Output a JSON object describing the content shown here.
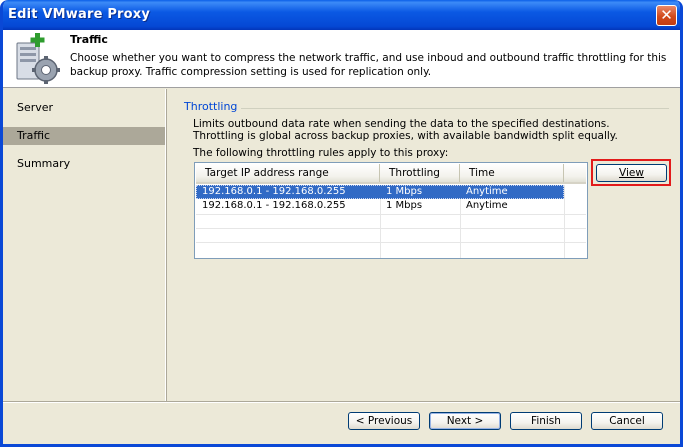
{
  "window": {
    "title": "Edit VMware Proxy"
  },
  "header": {
    "title": "Traffic",
    "description": "Choose whether you want to compress the network traffic, and use inboud and outbound traffic throttling for this backup proxy. Traffic compression setting is used for replication only.",
    "icon": "server-gear-icon"
  },
  "sidebar": {
    "items": [
      {
        "label": "Server",
        "active": false
      },
      {
        "label": "Traffic",
        "active": true
      },
      {
        "label": "Summary",
        "active": false
      }
    ]
  },
  "throttling": {
    "section_title": "Throttling",
    "description_line1": "Limits outbound data rate when sending the data to the specified destinations.",
    "description_line2": "Throttling is global across backup proxies, with available bandwidth split equally.",
    "rules_label": "The following throttling rules apply to this proxy:",
    "columns": [
      "Target IP address range",
      "Throttling",
      "Time"
    ],
    "rows": [
      {
        "range": "192.168.0.1 - 192.168.0.255",
        "throttling": "1 Mbps",
        "time": "Anytime",
        "selected": true
      },
      {
        "range": "192.168.0.1 - 192.168.0.255",
        "throttling": "1 Mbps",
        "time": "Anytime",
        "selected": false
      }
    ],
    "view_button": "View"
  },
  "footer": {
    "previous": "< Previous",
    "next": "Next >",
    "finish": "Finish",
    "cancel": "Cancel"
  },
  "colors": {
    "titlebar": "#0a5fe8",
    "selection": "#316ac5",
    "section_title": "#0046d5",
    "highlight_box": "#e21b1b"
  }
}
